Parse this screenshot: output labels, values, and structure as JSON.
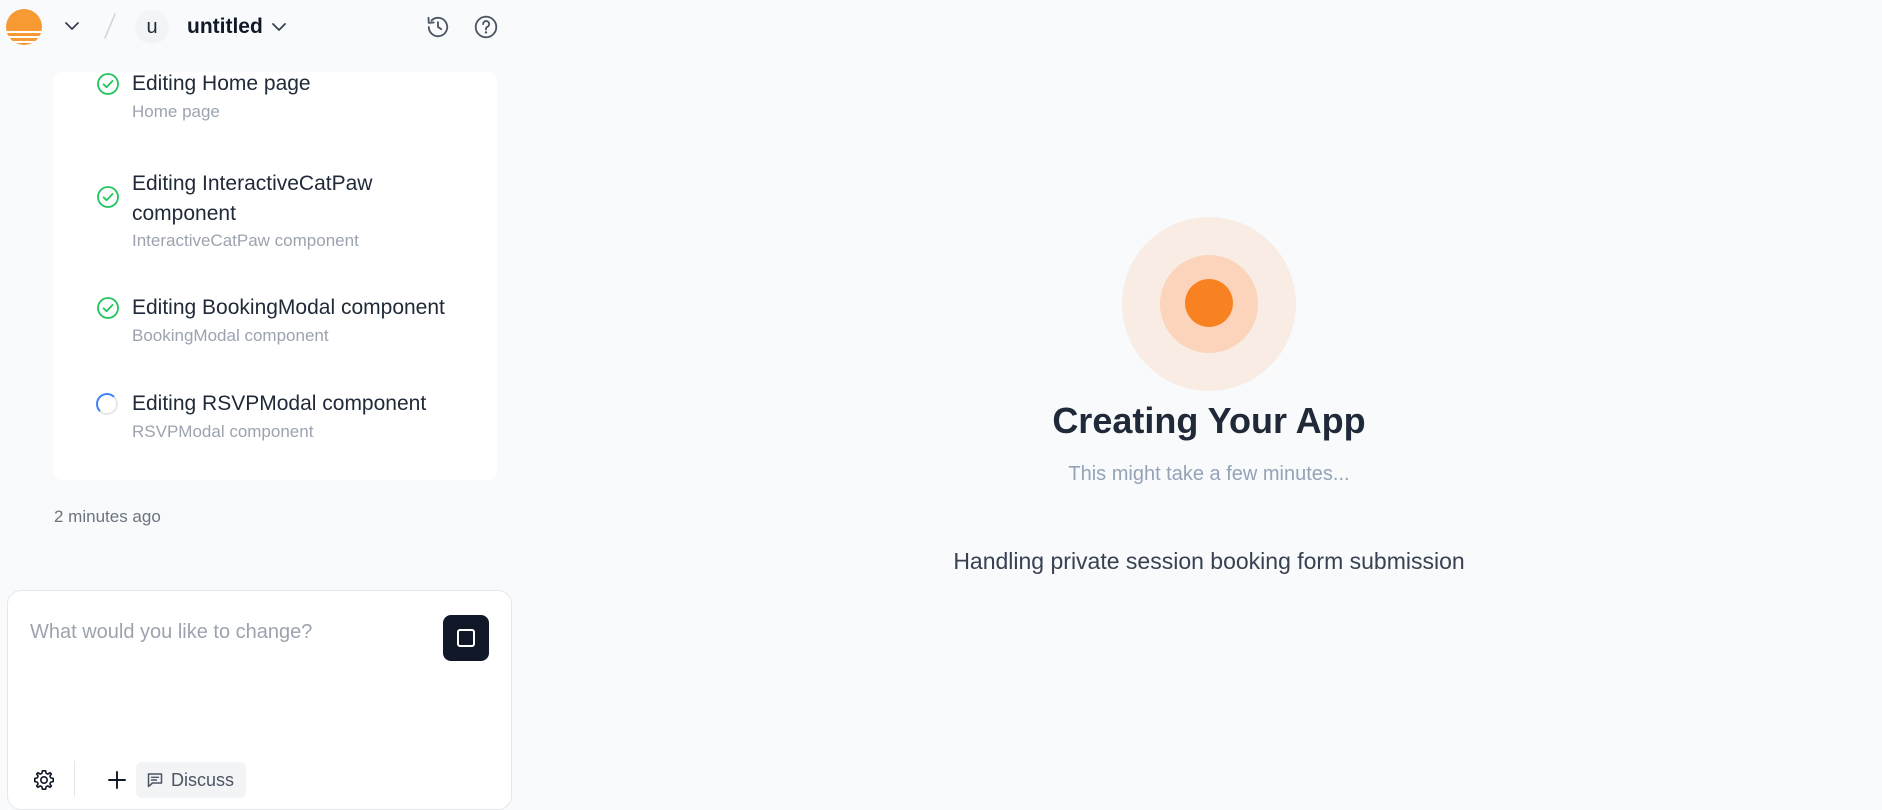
{
  "header": {
    "avatar_initial": "u",
    "project_name": "untitled"
  },
  "tasks": [
    {
      "title": "Editing Home page",
      "subtitle": "Home page",
      "status": "done"
    },
    {
      "title": "Editing InteractiveCatPaw component",
      "subtitle": "InteractiveCatPaw component",
      "status": "done"
    },
    {
      "title": "Editing BookingModal component",
      "subtitle": "BookingModal component",
      "status": "done"
    },
    {
      "title": "Editing RSVPModal component",
      "subtitle": "RSVPModal component",
      "status": "in-progress"
    }
  ],
  "timestamp": "2 minutes ago",
  "chat": {
    "placeholder": "What would you like to change?",
    "discuss_label": "Discuss"
  },
  "main": {
    "title": "Creating Your App",
    "subtitle": "This might take a few minutes...",
    "status": "Handling private session booking form submission"
  },
  "colors": {
    "accent": "#f88222",
    "success": "#22c55e",
    "spinner": "#3b82f6",
    "dark_button": "#111827"
  },
  "icons": {
    "logo": "sunset-logo",
    "history": "history-icon",
    "help": "help-circle-icon",
    "task_done": "check-circle-icon",
    "task_pending": "spinner-icon",
    "stop": "stop-square-icon",
    "settings": "gear-icon",
    "add": "plus-icon",
    "discuss": "message-icon"
  }
}
